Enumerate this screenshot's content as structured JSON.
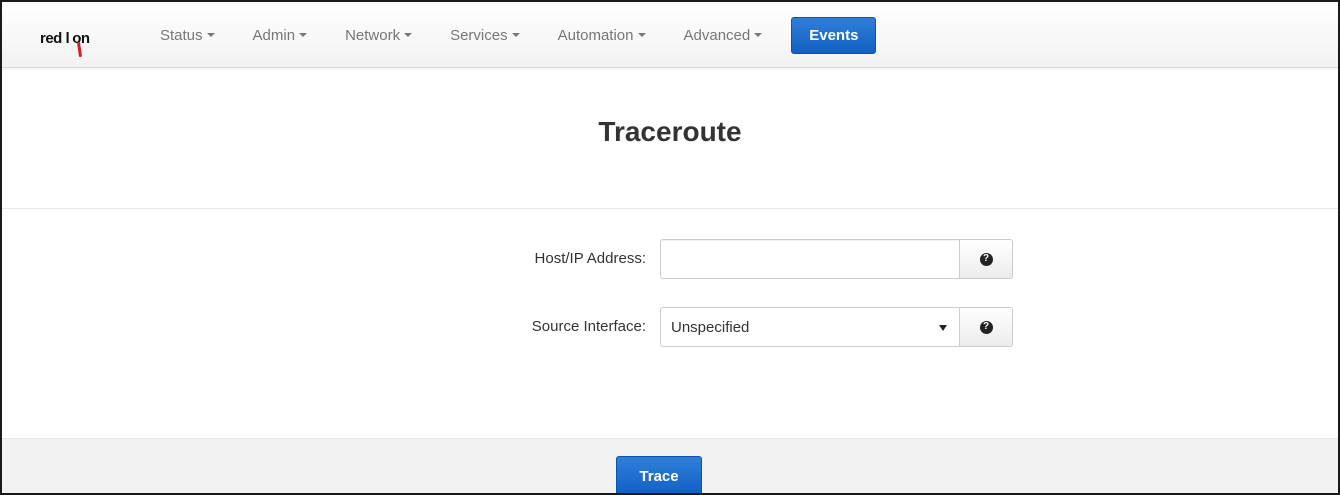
{
  "brand": {
    "text_left": "red l",
    "text_right": "on",
    "accent_color": "#d62020"
  },
  "nav": {
    "items": [
      {
        "label": "Status",
        "has_dropdown": true
      },
      {
        "label": "Admin",
        "has_dropdown": true
      },
      {
        "label": "Network",
        "has_dropdown": true
      },
      {
        "label": "Services",
        "has_dropdown": true
      },
      {
        "label": "Automation",
        "has_dropdown": true
      },
      {
        "label": "Advanced",
        "has_dropdown": true
      }
    ],
    "active": {
      "label": "Events",
      "color": "#1a6fd1"
    }
  },
  "page": {
    "title": "Traceroute"
  },
  "form": {
    "host": {
      "label": "Host/IP Address:",
      "value": "",
      "placeholder": "",
      "help_icon": "question-circle-icon"
    },
    "source_interface": {
      "label": "Source Interface:",
      "selected": "Unspecified",
      "help_icon": "question-circle-icon"
    }
  },
  "footer": {
    "trace_label": "Trace",
    "help_glyph": "?"
  }
}
